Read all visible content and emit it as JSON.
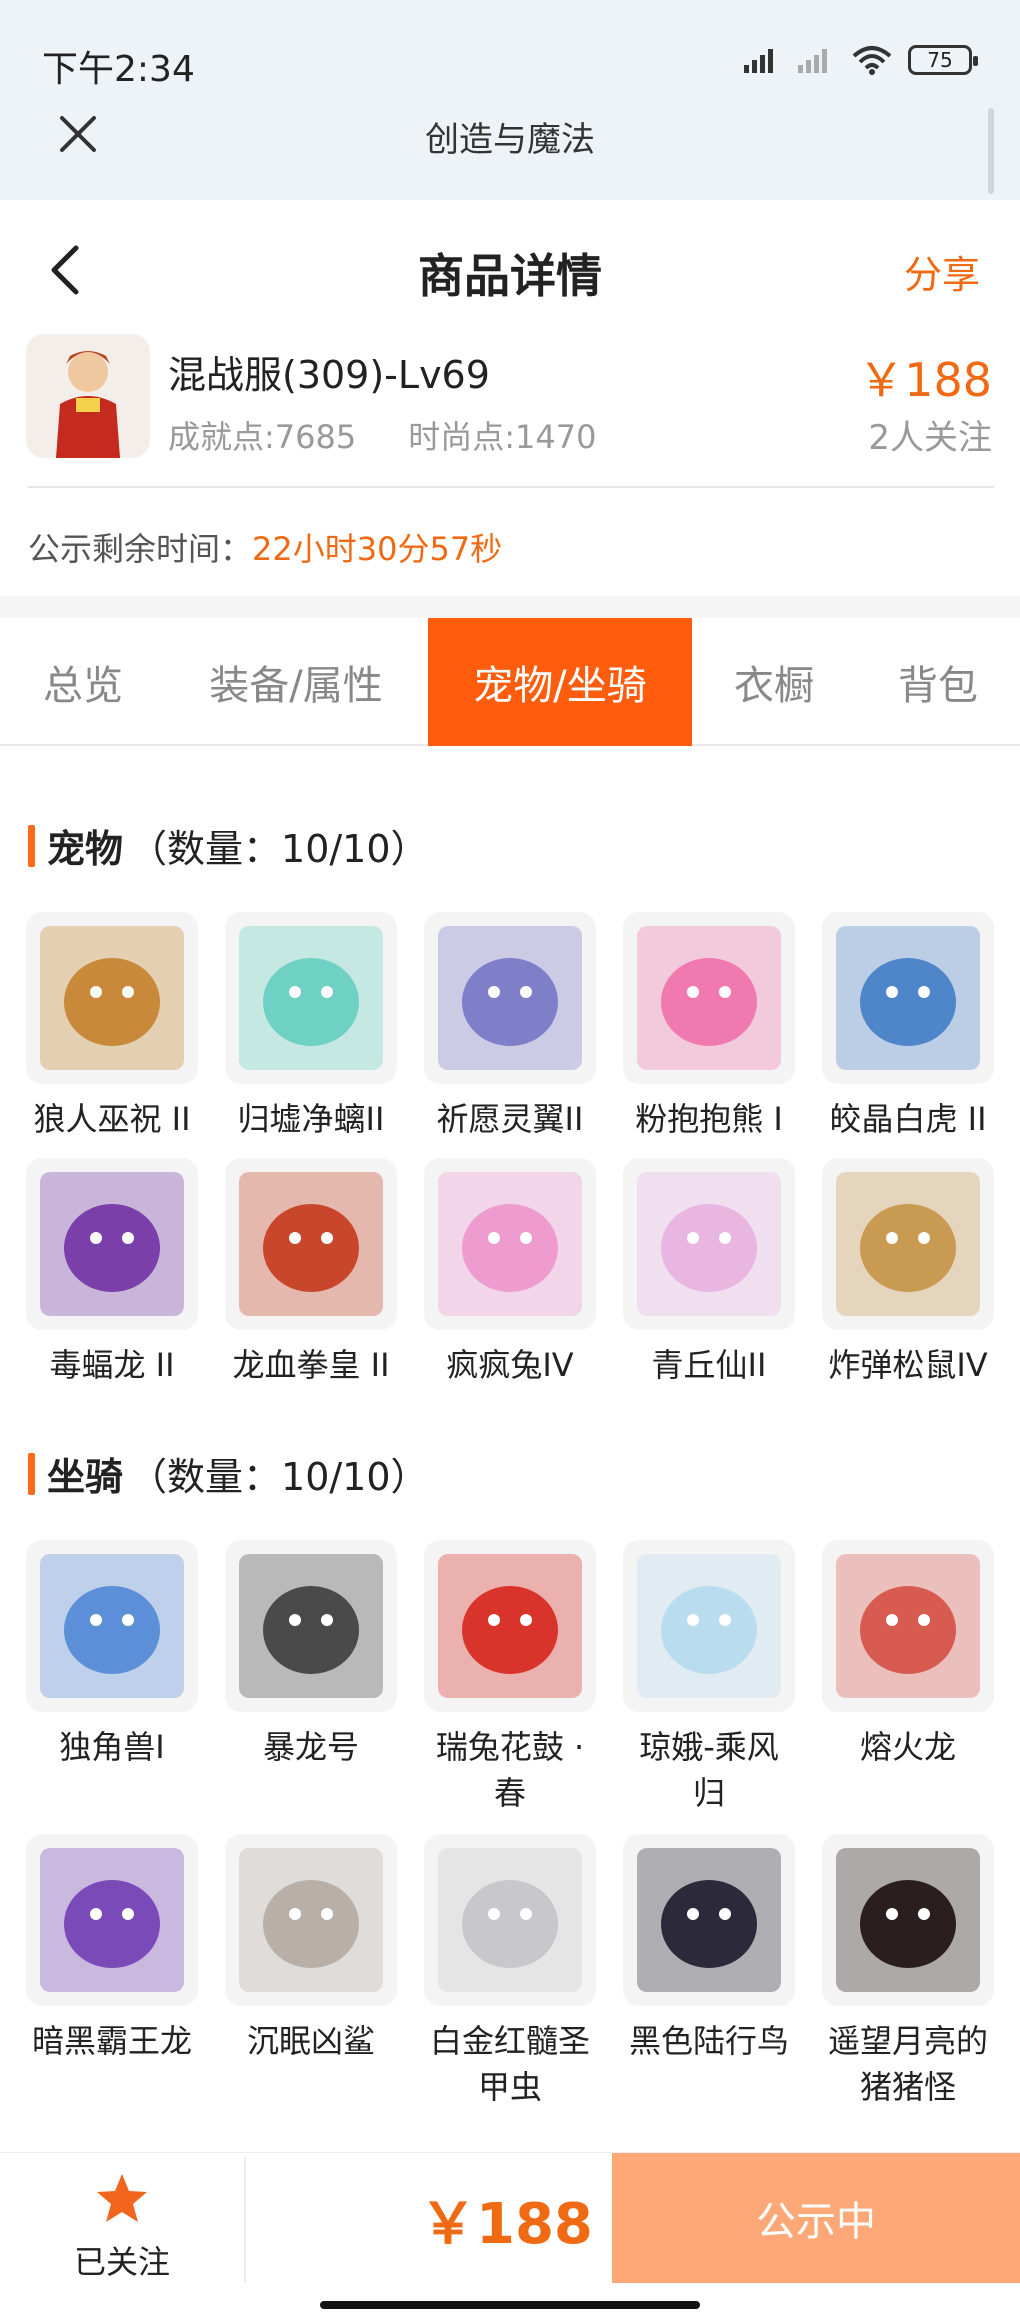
{
  "status_bar": {
    "time": "下午2:34",
    "battery": "75"
  },
  "app": {
    "title": "创造与魔法"
  },
  "nav": {
    "title": "商品详情",
    "share": "分享"
  },
  "product": {
    "name": "混战服(309)-Lv69",
    "achievement": "成就点:7685",
    "fashion": "时尚点:1470",
    "price": "￥188",
    "followers": "2人关注"
  },
  "countdown": {
    "label": "公示剩余时间：",
    "value": "22小时30分57秒"
  },
  "tabs": [
    "总览",
    "装备/属性",
    "宠物/坐骑",
    "衣橱",
    "背包"
  ],
  "active_tab": "宠物/坐骑",
  "pets": {
    "title": "宠物",
    "count": "（数量：10/10）",
    "items": [
      {
        "name": "狼人巫祝 II",
        "icon": "wolf-shaman-pet-icon",
        "color": "#c8893a"
      },
      {
        "name": "归墟净螭II",
        "icon": "water-dragon-pet-icon",
        "color": "#6fd0c4"
      },
      {
        "name": "祈愿灵翼II",
        "icon": "bird-pet-icon",
        "color": "#7f7fc9"
      },
      {
        "name": "粉抱抱熊 I",
        "icon": "pink-bear-pet-icon",
        "color": "#f07ab0"
      },
      {
        "name": "皎晶白虎 II",
        "icon": "white-tiger-pet-icon",
        "color": "#4f86c9"
      },
      {
        "name": "毒蝠龙 II",
        "icon": "bat-dragon-pet-icon",
        "color": "#7a3fa8"
      },
      {
        "name": "龙血拳皇 II",
        "icon": "dragon-boxer-pet-icon",
        "color": "#c8472c"
      },
      {
        "name": "疯疯兔IV",
        "icon": "rabbit-pet-icon",
        "color": "#ee9bd0"
      },
      {
        "name": "青丘仙II",
        "icon": "fox-fairy-pet-icon",
        "color": "#e9b6e2"
      },
      {
        "name": "炸弹松鼠IV",
        "icon": "squirrel-pet-icon",
        "color": "#c89a52"
      }
    ]
  },
  "mounts": {
    "title": "坐骑",
    "count": "（数量：10/10）",
    "items": [
      {
        "name": "独角兽I",
        "icon": "unicorn-mount-icon",
        "color": "#5b8fd8"
      },
      {
        "name": "暴龙号",
        "icon": "mech-dinosaur-mount-icon",
        "color": "#4a4a4a"
      },
      {
        "name": "瑞兔花鼓 · 春",
        "icon": "drum-mount-icon",
        "color": "#d9342b"
      },
      {
        "name": "琼娥-乘风归",
        "icon": "fairy-mount-icon",
        "color": "#b9dcef"
      },
      {
        "name": "熔火龙",
        "icon": "fire-dragon-mount-icon",
        "color": "#d85b52"
      },
      {
        "name": "暗黑霸王龙",
        "icon": "dark-trex-mount-icon",
        "color": "#7a4ab8"
      },
      {
        "name": "沉眠凶鲨",
        "icon": "shark-mount-icon",
        "color": "#b8b0a8"
      },
      {
        "name": "白金红髓圣甲虫",
        "icon": "beetle-mount-icon",
        "color": "#c8c8cc"
      },
      {
        "name": "黑色陆行鸟",
        "icon": "black-bird-mount-icon",
        "color": "#2c2a3a"
      },
      {
        "name": "遥望月亮的猪猪怪",
        "icon": "pig-monster-mount-icon",
        "color": "#2a1e1e"
      }
    ]
  },
  "bottom": {
    "followed": "已关注",
    "price": "￥188",
    "status": "公示中"
  }
}
